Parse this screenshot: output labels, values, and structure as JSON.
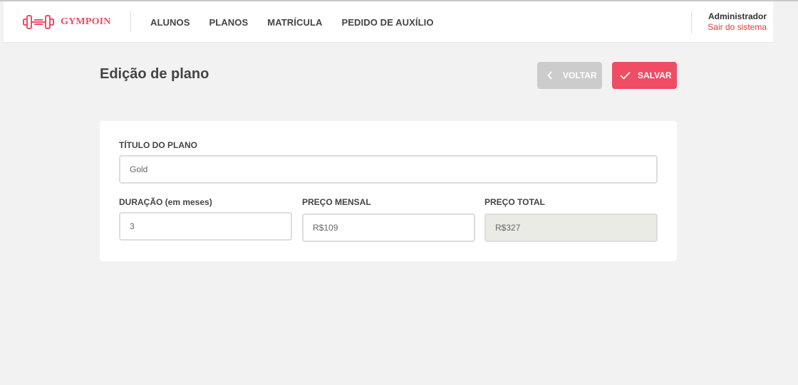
{
  "app": {
    "brand": "GYMPOIN"
  },
  "nav": {
    "items": [
      {
        "label": "ALUNOS"
      },
      {
        "label": "PLANOS"
      },
      {
        "label": "MATRÍCULA"
      },
      {
        "label": "PEDIDO DE AUXÍLIO"
      }
    ]
  },
  "user": {
    "name": "Administrador",
    "logout": "Sair do sistema"
  },
  "page": {
    "title": "Edição de plano"
  },
  "actions": {
    "back_label": "VOLTAR",
    "save_label": "SALVAR"
  },
  "form": {
    "title": {
      "label": "TÍTULO DO PLANO",
      "value": "Gold"
    },
    "duration": {
      "label": "DURAÇÃO (em meses)",
      "value": "3"
    },
    "monthly_price": {
      "label": "PREÇO MENSAL",
      "value": "R$109"
    },
    "total_price": {
      "label": "PREÇO TOTAL",
      "value": "R$327"
    }
  },
  "colors": {
    "accent": "#ee4d64",
    "logout_link": "#de3b3b",
    "back_button": "#cccccc",
    "background": "#f2f2f2",
    "disabled_field": "#ebebe6"
  },
  "icons": {
    "logo": "dumbbell-icon",
    "back": "chevron-left-icon",
    "save": "check-icon"
  }
}
